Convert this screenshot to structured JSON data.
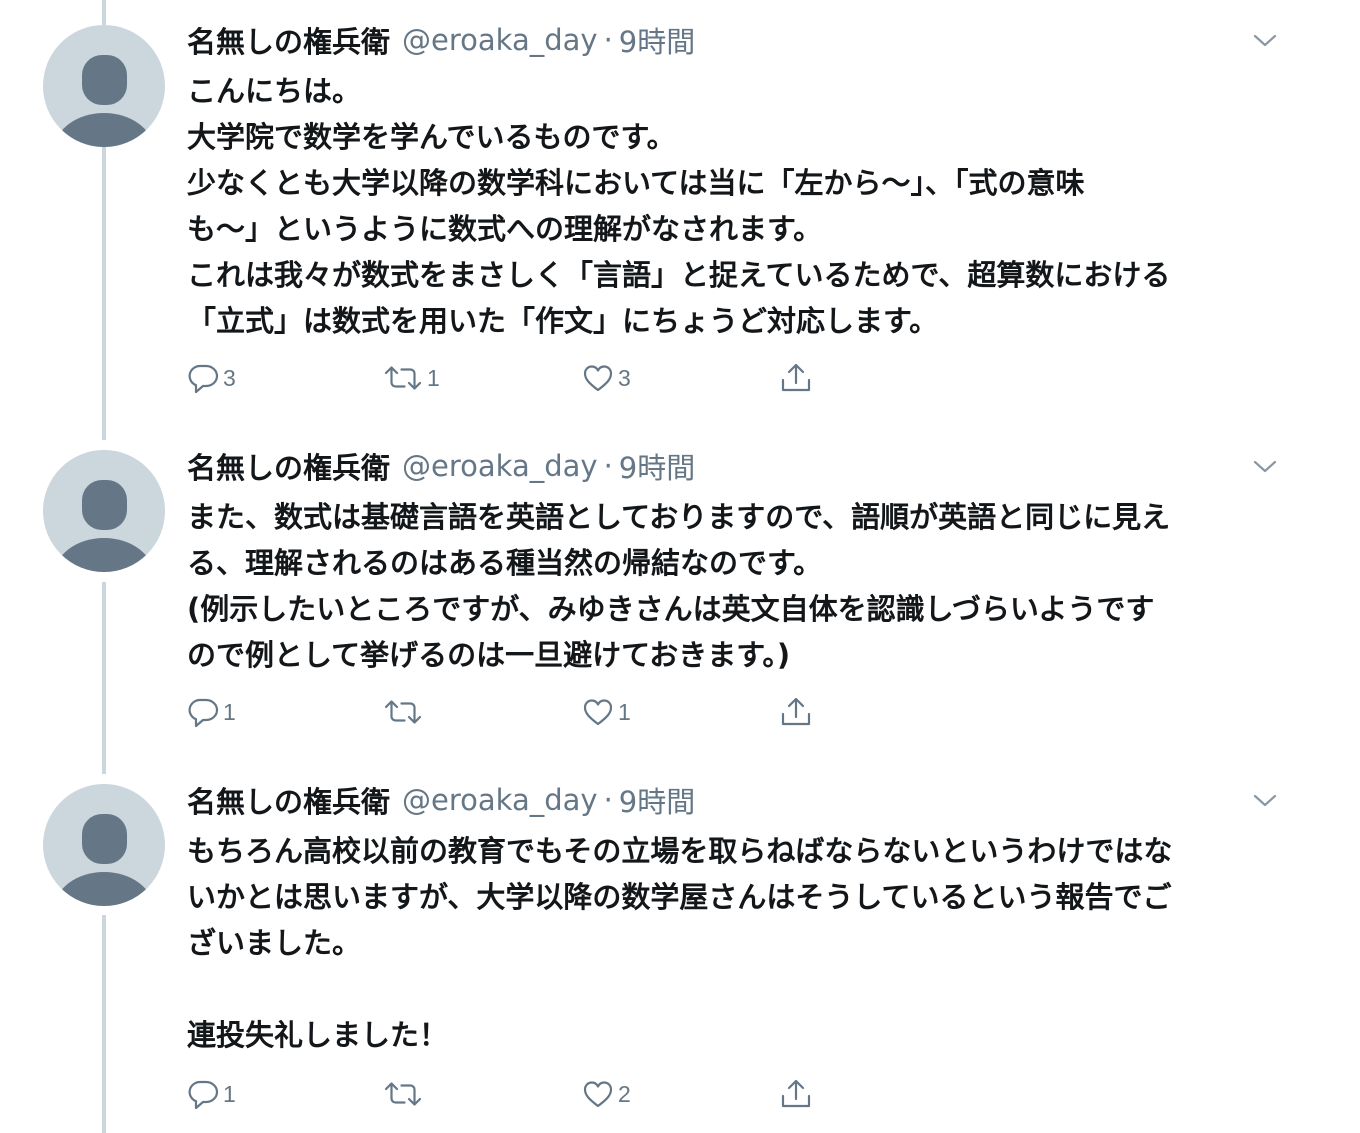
{
  "tweets": [
    {
      "author": {
        "name": "名無しの権兵衛",
        "handle": "@eroaka_day",
        "separator": "·",
        "time": "9時間"
      },
      "lines": [
        "こんにちは。",
        "大学院で数学を学んでいるものです。",
        "少なくとも大学以降の数学科においては当に「左から〜」、「式の意味",
        "も〜」というように数式への理解がなされます。",
        "これは我々が数式をまさしく「言語」と捉えているためで、超算数における",
        "「立式」は数式を用いた「作文」にちょうど対応します。"
      ],
      "replies": "3",
      "retweets": "1",
      "likes": "3"
    },
    {
      "author": {
        "name": "名無しの権兵衛",
        "handle": "@eroaka_day",
        "separator": "·",
        "time": "9時間"
      },
      "lines": [
        "また、数式は基礎言語を英語としておりますので、語順が英語と同じに見え",
        "る、理解されるのはある種当然の帰結なのです。",
        "(例示したいところですが、みゆきさんは英文自体を認識しづらいようです",
        "ので例として挙げるのは一旦避けておきます。)"
      ],
      "replies": "1",
      "retweets": "",
      "likes": "1"
    },
    {
      "author": {
        "name": "名無しの権兵衛",
        "handle": "@eroaka_day",
        "separator": "·",
        "time": "9時間"
      },
      "lines": [
        "もちろん高校以前の教育でもその立場を取らねばならないというわけではな",
        "いかとは思いますが、大学以降の数学屋さんはそうしているという報告でご",
        "ざいました。",
        "",
        "連投失礼しました！"
      ],
      "replies": "1",
      "retweets": "",
      "likes": "2"
    }
  ],
  "icons": {
    "avatar": "default-profile-icon",
    "caret": "chevron-down-icon",
    "reply": "reply-bubble-icon",
    "retweet": "retweet-icon",
    "like": "heart-icon",
    "share": "share-icon"
  },
  "colors": {
    "text": "#14171a",
    "secondary": "#657786",
    "avatar_bg": "#ccd6dd",
    "avatar_fg": "#657786",
    "thread_line": "#ccd6dd"
  }
}
